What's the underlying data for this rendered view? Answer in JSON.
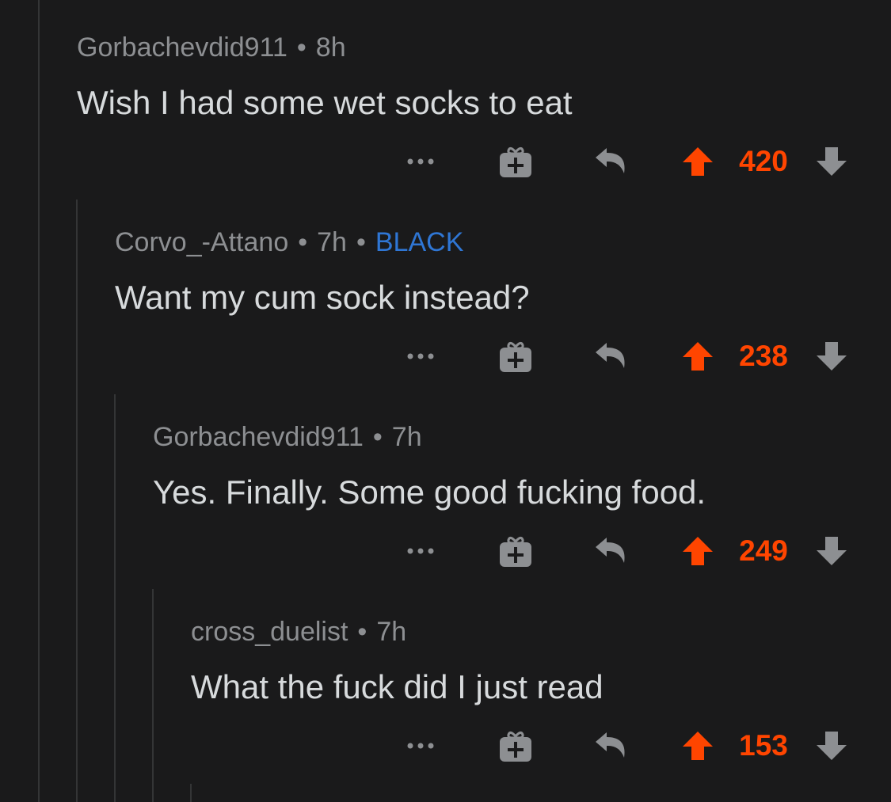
{
  "colors": {
    "background": "#1a1a1b",
    "meta_text": "#8d8f92",
    "body_text": "#d7dadc",
    "flair": "#2f76d4",
    "upvoted": "#ff4500",
    "icon_grey": "#8d8f92",
    "thread_line": "#343536"
  },
  "icons": {
    "more": "more-dots-icon",
    "gift": "gift-award-icon",
    "reply": "reply-arrow-icon",
    "upvote": "upvote-arrow-icon",
    "downvote": "downvote-arrow-icon"
  },
  "comments": [
    {
      "author": "Gorbachevdid911",
      "separator": "•",
      "time": "8h",
      "flair": "",
      "body": "Wish I had some wet socks to eat",
      "score": "420",
      "upvoted": true
    },
    {
      "author": "Corvo_-Attano",
      "separator": "•",
      "time": "7h",
      "flair": "BLACK",
      "body": "Want my cum sock instead?",
      "score": "238",
      "upvoted": true
    },
    {
      "author": "Gorbachevdid911",
      "separator": "•",
      "time": "7h",
      "flair": "",
      "body": "Yes. Finally. Some good fucking food.",
      "score": "249",
      "upvoted": true
    },
    {
      "author": "cross_duelist",
      "separator": "•",
      "time": "7h",
      "flair": "",
      "body": "What the fuck did I just read",
      "score": "153",
      "upvoted": true
    }
  ]
}
